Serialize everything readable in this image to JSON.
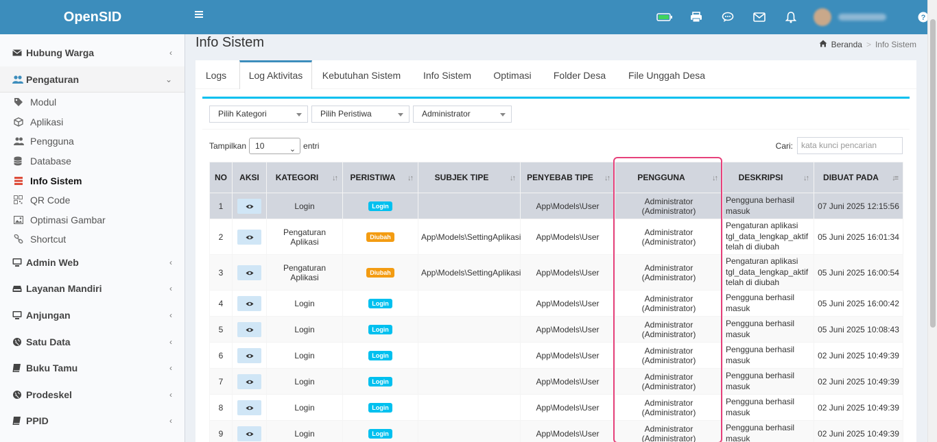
{
  "app": {
    "name": "OpenSID"
  },
  "header": {
    "icons": [
      "battery-icon",
      "print-icon",
      "chat-icon",
      "mail-icon",
      "bell-icon"
    ],
    "help": "?"
  },
  "sidebar": {
    "items": [
      {
        "label": "Hubung Warga",
        "icon": "envelope-icon",
        "chevron": "‹"
      },
      {
        "label": "Pengaturan",
        "icon": "users-icon",
        "chevron": "⌄"
      },
      {
        "label": "Admin Web",
        "icon": "desktop-icon",
        "chevron": "‹"
      },
      {
        "label": "Layanan Mandiri",
        "icon": "inbox-icon",
        "chevron": "‹"
      },
      {
        "label": "Anjungan",
        "icon": "monitor-icon",
        "chevron": "‹"
      },
      {
        "label": "Satu Data",
        "icon": "globe-icon",
        "chevron": "‹"
      },
      {
        "label": "Buku Tamu",
        "icon": "book-icon",
        "chevron": "‹"
      },
      {
        "label": "Prodeskel",
        "icon": "globe-icon",
        "chevron": "‹"
      },
      {
        "label": "PPID",
        "icon": "book-icon",
        "chevron": "‹"
      }
    ],
    "sub": [
      {
        "label": "Modul",
        "icon": "tags-icon"
      },
      {
        "label": "Aplikasi",
        "icon": "cube-icon"
      },
      {
        "label": "Pengguna",
        "icon": "users-icon"
      },
      {
        "label": "Database",
        "icon": "database-icon"
      },
      {
        "label": "Info Sistem",
        "icon": "server-icon"
      },
      {
        "label": "QR Code",
        "icon": "qrcode-icon"
      },
      {
        "label": "Optimasi Gambar",
        "icon": "image-icon"
      },
      {
        "label": "Shortcut",
        "icon": "link-icon"
      }
    ]
  },
  "page": {
    "title": "Info Sistem",
    "breadcrumb": {
      "home": "Beranda",
      "sep": ">",
      "current": "Info Sistem"
    }
  },
  "tabs": [
    "Logs",
    "Log Aktivitas",
    "Kebutuhan Sistem",
    "Info Sistem",
    "Optimasi",
    "Folder Desa",
    "File Unggah Desa"
  ],
  "filters": {
    "kategori": "Pilih Kategori",
    "peristiwa": "Pilih Peristiwa",
    "pengguna": "Administrator"
  },
  "length": {
    "before": "Tampilkan",
    "value": "10",
    "after": "entri"
  },
  "search": {
    "label": "Cari:",
    "placeholder": "kata kunci pencarian"
  },
  "table": {
    "headers": [
      "NO",
      "AKSI",
      "KATEGORI",
      "PERISTIWA",
      "SUBJEK TIPE",
      "PENYEBAB TIPE",
      "PENGGUNA",
      "DESKRIPSI",
      "DIBUAT PADA"
    ],
    "rows": [
      {
        "no": "1",
        "kategori": "Login",
        "peristiwa": "Login",
        "subjek": "",
        "penyebab": "App\\Models\\User",
        "pengguna": "Administrator (Administrator)",
        "desk": [
          "Pengguna berhasil",
          "masuk"
        ],
        "dibuat": "07 Juni 2025 12:15:56"
      },
      {
        "no": "2",
        "kategori": "Pengaturan Aplikasi",
        "peristiwa": "Diubah",
        "subjek": "App\\Models\\SettingAplikasi",
        "penyebab": "App\\Models\\User",
        "pengguna": "Administrator (Administrator)",
        "desk": [
          "Pengaturan aplikasi",
          "tgl_data_lengkap_aktif",
          "telah di diubah"
        ],
        "dibuat": "05 Juni 2025 16:01:34"
      },
      {
        "no": "3",
        "kategori": "Pengaturan Aplikasi",
        "peristiwa": "Diubah",
        "subjek": "App\\Models\\SettingAplikasi",
        "penyebab": "App\\Models\\User",
        "pengguna": "Administrator (Administrator)",
        "desk": [
          "Pengaturan aplikasi",
          "tgl_data_lengkap_aktif",
          "telah di diubah"
        ],
        "dibuat": "05 Juni 2025 16:00:54"
      },
      {
        "no": "4",
        "kategori": "Login",
        "peristiwa": "Login",
        "subjek": "",
        "penyebab": "App\\Models\\User",
        "pengguna": "Administrator (Administrator)",
        "desk": [
          "Pengguna berhasil",
          "masuk"
        ],
        "dibuat": "05 Juni 2025 16:00:42"
      },
      {
        "no": "5",
        "kategori": "Login",
        "peristiwa": "Login",
        "subjek": "",
        "penyebab": "App\\Models\\User",
        "pengguna": "Administrator (Administrator)",
        "desk": [
          "Pengguna berhasil",
          "masuk"
        ],
        "dibuat": "05 Juni 2025 10:08:43"
      },
      {
        "no": "6",
        "kategori": "Login",
        "peristiwa": "Login",
        "subjek": "",
        "penyebab": "App\\Models\\User",
        "pengguna": "Administrator (Administrator)",
        "desk": [
          "Pengguna berhasil",
          "masuk"
        ],
        "dibuat": "02 Juni 2025 10:49:39"
      },
      {
        "no": "7",
        "kategori": "Login",
        "peristiwa": "Login",
        "subjek": "",
        "penyebab": "App\\Models\\User",
        "pengguna": "Administrator (Administrator)",
        "desk": [
          "Pengguna berhasil",
          "masuk"
        ],
        "dibuat": "02 Juni 2025 10:49:39"
      },
      {
        "no": "8",
        "kategori": "Login",
        "peristiwa": "Login",
        "subjek": "",
        "penyebab": "App\\Models\\User",
        "pengguna": "Administrator (Administrator)",
        "desk": [
          "Pengguna berhasil",
          "masuk"
        ],
        "dibuat": "02 Juni 2025 10:49:39"
      },
      {
        "no": "9",
        "kategori": "Login",
        "peristiwa": "Login",
        "subjek": "",
        "penyebab": "App\\Models\\User",
        "pengguna": "Administrator (Administrator)",
        "desk": [
          "Pengguna berhasil",
          "masuk"
        ],
        "dibuat": "02 Juni 2025 10:49:39"
      }
    ]
  },
  "colors": {
    "primary": "#3c8dbc",
    "info": "#00c0ef",
    "warning": "#f39c12",
    "highlight": "#e6407a"
  }
}
